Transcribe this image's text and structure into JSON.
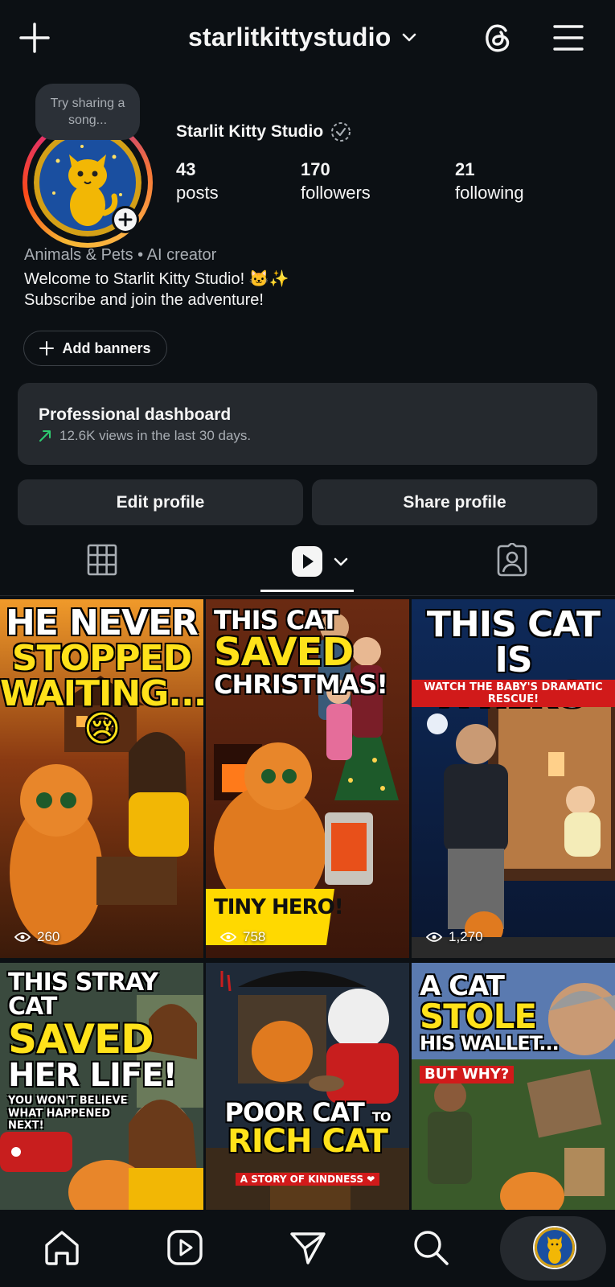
{
  "header": {
    "username": "starlitkittystudio"
  },
  "profile": {
    "note_bubble": "Try sharing a song...",
    "display_name": "Starlit Kitty Studio",
    "stats": {
      "posts_count": "43",
      "posts_label": "posts",
      "followers_count": "170",
      "followers_label": "followers",
      "following_count": "21",
      "following_label": "following"
    },
    "category": "Animals & Pets • AI creator",
    "bio_line1": "Welcome to Starlit Kitty Studio! 🐱✨",
    "bio_line2": "Subscribe and join the adventure!",
    "add_banners_label": "Add banners"
  },
  "dashboard": {
    "title": "Professional dashboard",
    "subtitle": "12.6K views in the last 30 days."
  },
  "buttons": {
    "edit_profile": "Edit profile",
    "share_profile": "Share profile"
  },
  "tabs": [
    {
      "name": "grid",
      "icon": "grid-icon"
    },
    {
      "name": "reels",
      "icon": "reels-icon",
      "selected": true
    },
    {
      "name": "tagged",
      "icon": "tagged-icon"
    }
  ],
  "posts": [
    {
      "title_line1": "HE NEVER",
      "title_line2": "STOPPED",
      "title_line3": "WAITING...😢",
      "views": "260"
    },
    {
      "title_line1": "THIS CAT",
      "title_line2": "SAVED",
      "title_line3": "CHRISTMAS!",
      "badge": "TINY HERO!",
      "views": "758"
    },
    {
      "title_line1": "THIS CAT IS",
      "title_line2": "A HERO",
      "subtitle": "WATCH THE BABY'S DRAMATIC RESCUE!",
      "views": "1,270"
    },
    {
      "title_line1": "THIS STRAY CAT",
      "title_line2": "SAVED",
      "title_line3": "HER LIFE!",
      "subtitle": "YOU WON'T BELIEVE WHAT HAPPENED NEXT!"
    },
    {
      "title_line1": "POOR CAT",
      "title_small": "TO",
      "title_line2": "RICH CAT",
      "subtitle": "A STORY OF KINDNESS ❤"
    },
    {
      "title_line1": "A CAT",
      "title_line2": "STOLE",
      "title_line3": "HIS WALLET...",
      "subtitle": "BUT WHY?"
    }
  ],
  "colors": {
    "background": "#0c1014",
    "card": "#25292e",
    "muted_text": "#a8adb3",
    "accent_green": "#2ecc71"
  },
  "nav": [
    "home-icon",
    "reels-icon",
    "messages-icon",
    "search-icon",
    "profile-avatar"
  ]
}
